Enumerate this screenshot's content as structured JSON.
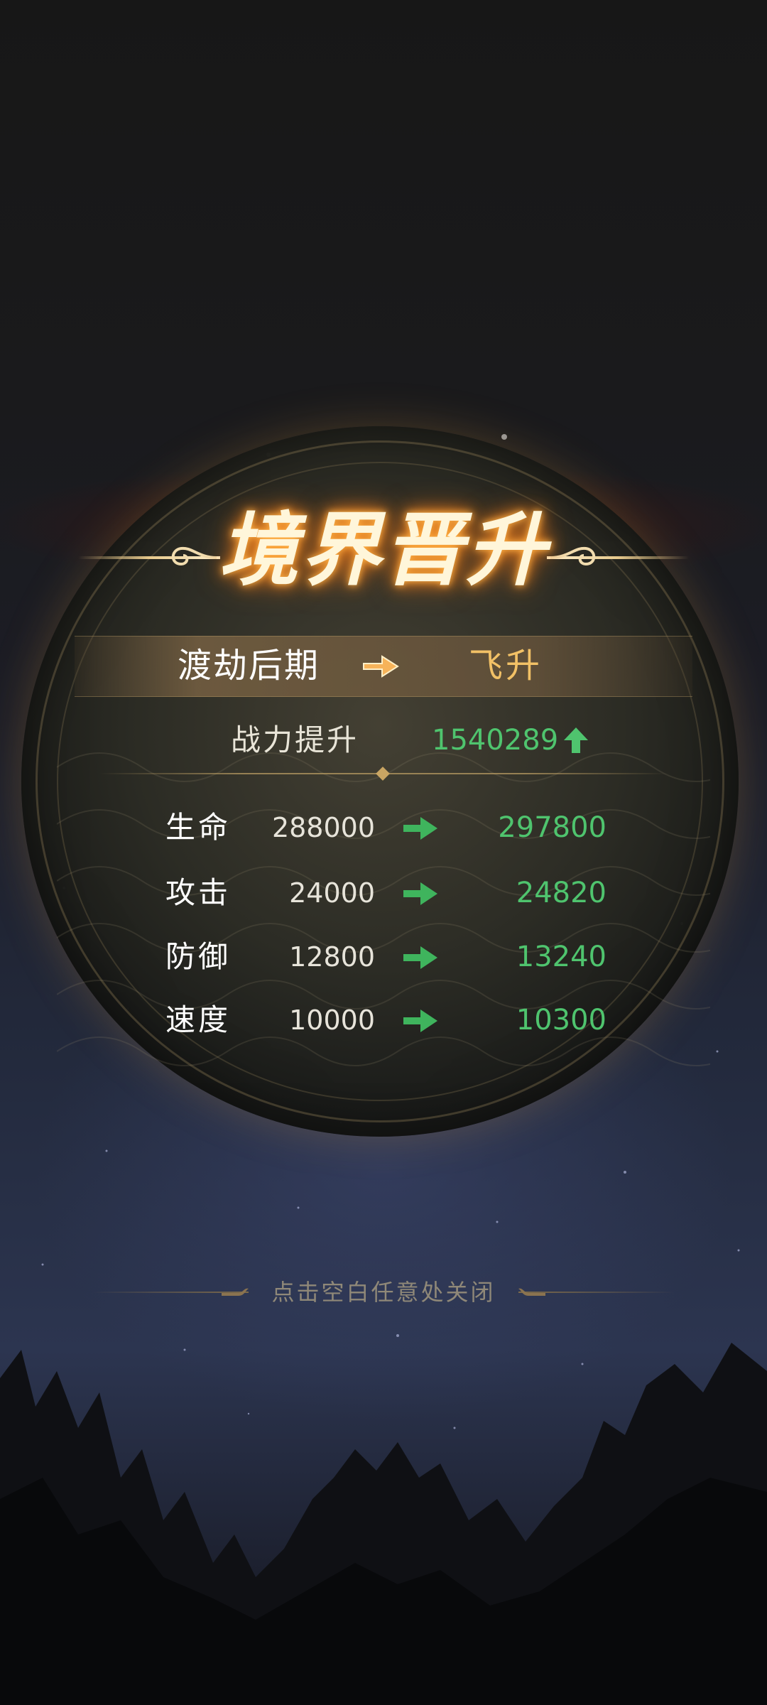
{
  "title": "境界晋升",
  "realm": {
    "from": "渡劫后期",
    "to": "飞升"
  },
  "power": {
    "label": "战力提升",
    "value": "1540289"
  },
  "stats": [
    {
      "name": "生命",
      "old": "288000",
      "new": "297800"
    },
    {
      "name": "攻击",
      "old": "24000",
      "new": "24820"
    },
    {
      "name": "防御",
      "old": "12800",
      "new": "13240"
    },
    {
      "name": "速度",
      "old": "10000",
      "new": "10300"
    }
  ],
  "hint": "点击空白任意处关闭",
  "colors": {
    "accent_gold": "#f2c166",
    "increase_green": "#4fc46e",
    "title_glow": "#ff8a1f"
  },
  "icons": {
    "realm_arrow": "arrow-right-icon",
    "power_up": "arrow-up-icon",
    "stat_arrow": "arrow-right-icon"
  }
}
